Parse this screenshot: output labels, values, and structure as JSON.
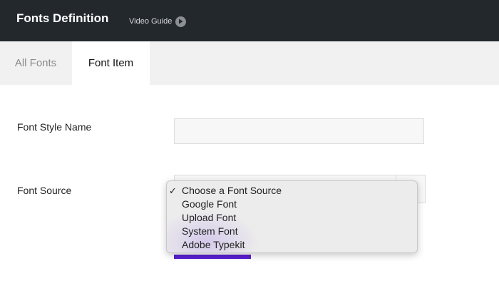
{
  "header": {
    "title": "Fonts Definition",
    "video_guide": "Video Guide"
  },
  "tabs": [
    {
      "label": "All Fonts",
      "active": false
    },
    {
      "label": "Font Item",
      "active": true
    }
  ],
  "form": {
    "font_style_name_label": "Font Style Name",
    "font_style_name_value": "",
    "font_source_label": "Font Source"
  },
  "dropdown": {
    "options": [
      {
        "label": "Choose a Font Source",
        "checked": true
      },
      {
        "label": "Google Font"
      },
      {
        "label": "Upload Font"
      },
      {
        "label": "System Font"
      },
      {
        "label": "Adobe Typekit"
      }
    ],
    "check_mark": "✓"
  },
  "colors": {
    "topbar": "#23282d",
    "accent": "#5a1fd1",
    "tabbar": "#f1f1f1"
  },
  "icons": {
    "video_guide": "play-circle-icon",
    "selected_option": "checkmark-icon"
  }
}
